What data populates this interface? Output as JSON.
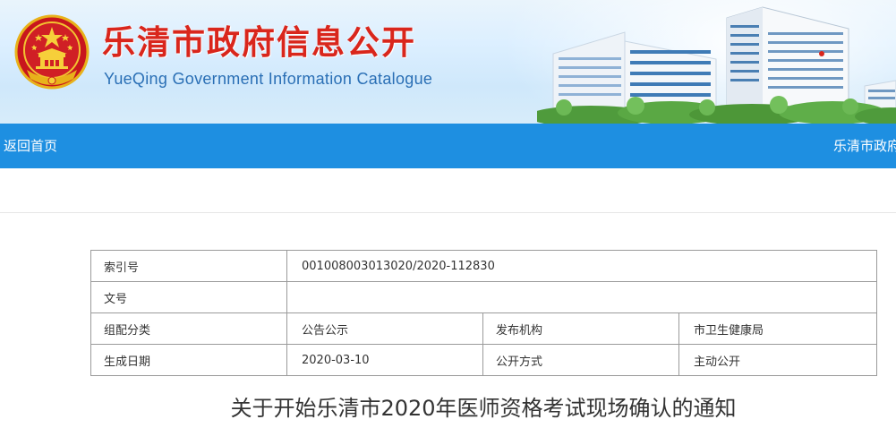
{
  "header": {
    "title": "乐清市政府信息公开",
    "subtitle": "YueQing Government Information Catalogue",
    "emblem_icon": "national-emblem-icon",
    "colors": {
      "title_red": "#d9261c",
      "subtitle_blue": "#2a6fb5"
    }
  },
  "nav": {
    "home_label": "返回首页",
    "right_label": "乐清市政府",
    "bar_color": "#1e8fe1"
  },
  "info": {
    "index_label": "索引号",
    "index_value": "001008003013020/2020-112830",
    "doc_no_label": "文号",
    "doc_no_value": "",
    "category_label": "组配分类",
    "category_value": "公告公示",
    "publisher_label": "发布机构",
    "publisher_value": "市卫生健康局",
    "date_label": "生成日期",
    "date_value": "2020-03-10",
    "disclosure_label": "公开方式",
    "disclosure_value": "主动公开"
  },
  "article": {
    "title": "关于开始乐清市2020年医师资格考试现场确认的通知"
  }
}
